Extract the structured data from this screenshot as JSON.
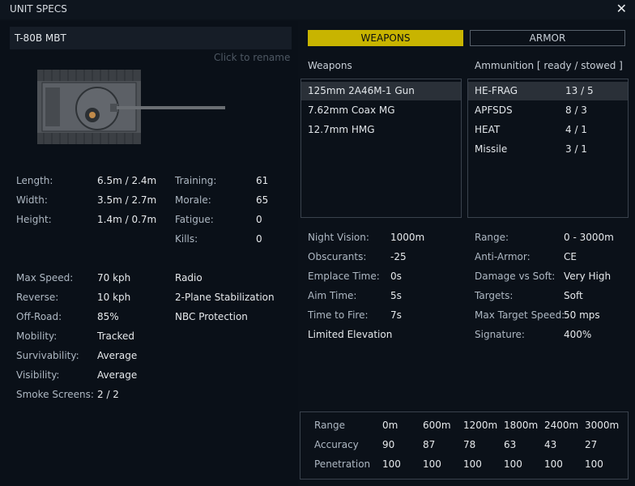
{
  "window": {
    "title": "UNIT SPECS",
    "close": "✕"
  },
  "unit": {
    "name": "T-80B MBT",
    "rename_hint": "Click to rename"
  },
  "stats_left": [
    {
      "label": "Length:",
      "value": "6.5m / 2.4m"
    },
    {
      "label": "Width:",
      "value": "3.5m / 2.7m"
    },
    {
      "label": "Height:",
      "value": "1.4m / 0.7m"
    }
  ],
  "stats_crew": [
    {
      "label": "Training:",
      "value": "61"
    },
    {
      "label": "Morale:",
      "value": "65"
    },
    {
      "label": "Fatigue:",
      "value": "0"
    },
    {
      "label": "Kills:",
      "value": "0"
    }
  ],
  "mobility": [
    {
      "label": "Max Speed:",
      "value": "70 kph"
    },
    {
      "label": "Reverse:",
      "value": "10 kph"
    },
    {
      "label": "Off-Road:",
      "value": "85%"
    },
    {
      "label": "Mobility:",
      "value": "Tracked"
    },
    {
      "label": "Survivability:",
      "value": "Average"
    },
    {
      "label": "Visibility:",
      "value": "Average"
    },
    {
      "label": "Smoke Screens:",
      "value": "2 / 2"
    }
  ],
  "features": [
    "Radio",
    "2-Plane Stabilization",
    "NBC Protection"
  ],
  "tabs": {
    "weapons": "WEAPONS",
    "armor": "ARMOR",
    "active": "weapons"
  },
  "weapons": {
    "heading": "Weapons",
    "items": [
      "125mm 2A46M-1 Gun",
      "7.62mm Coax MG",
      "12.7mm HMG"
    ],
    "selected": 0
  },
  "ammo": {
    "heading": "Ammunition [ ready / stowed ]",
    "items": [
      {
        "name": "HE-FRAG",
        "count": "13 / 5"
      },
      {
        "name": "APFSDS",
        "count": "8 / 3"
      },
      {
        "name": "HEAT",
        "count": "4 / 1"
      },
      {
        "name": "Missile",
        "count": "3 / 1"
      }
    ],
    "selected": 0
  },
  "weapon_stats": [
    {
      "label": "Night Vision:",
      "value": "1000m"
    },
    {
      "label": "Obscurants:",
      "value": "-25"
    },
    {
      "label": "Emplace Time:",
      "value": "0s"
    },
    {
      "label": "Aim Time:",
      "value": "5s"
    },
    {
      "label": "Time to Fire:",
      "value": "7s"
    }
  ],
  "weapon_note": "Limited Elevation",
  "ammo_stats": [
    {
      "label": "Range:",
      "value": "0 - 3000m"
    },
    {
      "label": "Anti-Armor:",
      "value": "CE"
    },
    {
      "label": "Damage vs Soft:",
      "value": "Very High"
    },
    {
      "label": "Targets:",
      "value": "Soft"
    },
    {
      "label": "Max Target Speed:",
      "value": "50 mps"
    },
    {
      "label": "Signature:",
      "value": "400%"
    }
  ],
  "range_table": {
    "rows": [
      {
        "label": "Range",
        "cells": [
          "0m",
          "600m",
          "1200m",
          "1800m",
          "2400m",
          "3000m"
        ]
      },
      {
        "label": "Accuracy",
        "cells": [
          "90",
          "87",
          "78",
          "63",
          "43",
          "27"
        ]
      },
      {
        "label": "Penetration",
        "cells": [
          "100",
          "100",
          "100",
          "100",
          "100",
          "100"
        ]
      }
    ]
  },
  "colors": {
    "accent": "#c8b400",
    "background": "#0b1119",
    "selection": "#2a3038"
  }
}
